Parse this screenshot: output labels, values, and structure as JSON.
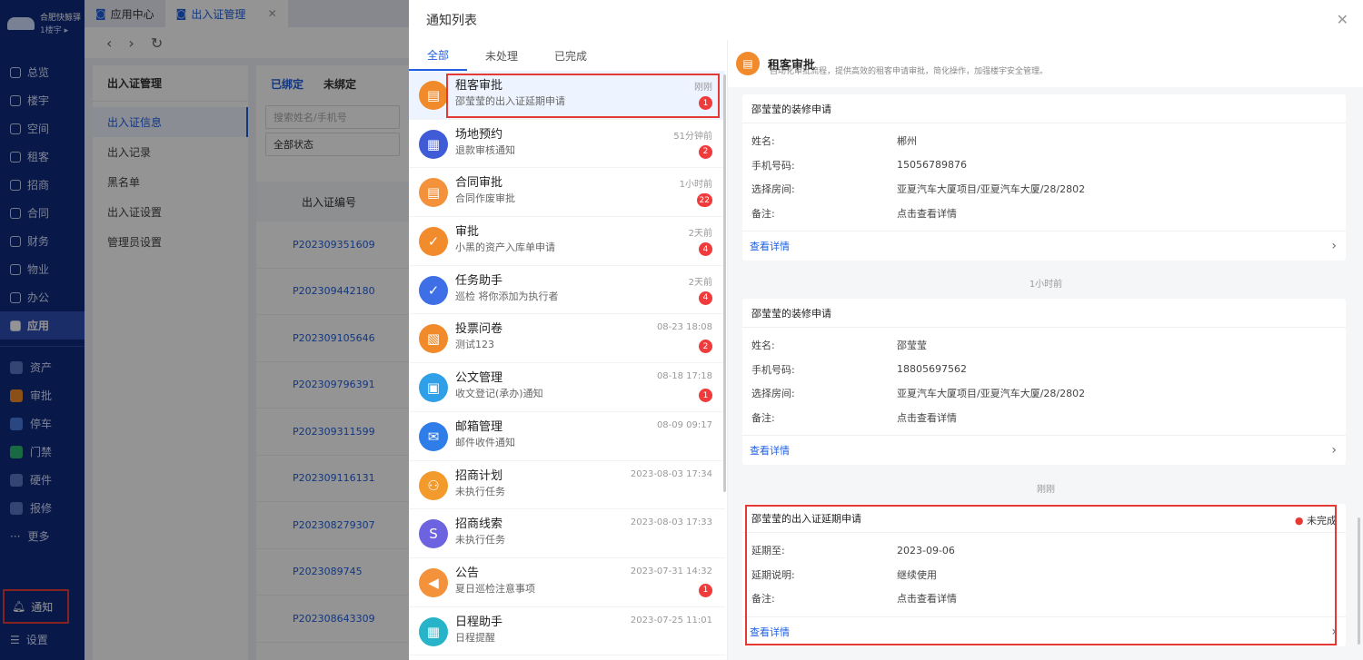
{
  "nav": {
    "brand": "合肥快鲸驿",
    "building": "1楼宇",
    "items": [
      "总览",
      "楼宇",
      "空间",
      "租客",
      "招商",
      "合同",
      "财务",
      "物业",
      "办公",
      "应用"
    ],
    "apps": [
      {
        "label": "资产",
        "color": "#5b78c9"
      },
      {
        "label": "审批",
        "color": "#f08a2a"
      },
      {
        "label": "停车",
        "color": "#4a7be0"
      },
      {
        "label": "门禁",
        "color": "#2bb673"
      },
      {
        "label": "硬件",
        "color": "#5b78c9"
      },
      {
        "label": "报修",
        "color": "#5b78c9"
      }
    ],
    "more": "更多",
    "notify": "通知",
    "settings": "设置"
  },
  "bg": {
    "tabs": [
      "应用中心",
      "出入证管理"
    ],
    "side_title": "出入证管理",
    "side_items": [
      "出入证信息",
      "出入记录",
      "黑名单",
      "出入证设置",
      "管理员设置"
    ],
    "main_tabs": [
      "已绑定",
      "未绑定"
    ],
    "search_placeholder": "搜索姓名/手机号",
    "status_select": "全部状态",
    "col_header": "出入证编号",
    "rows": [
      "P202309351609",
      "P202309442180",
      "P202309105646",
      "P202309796391",
      "P202309311599",
      "P202309116131",
      "P202308279307",
      "P2023089745",
      "P202308643309"
    ]
  },
  "drawer": {
    "title": "通知列表",
    "tabs": [
      "全部",
      "未处理",
      "已完成"
    ],
    "list": [
      {
        "title": "租客审批",
        "sub": "邵莹莹的出入证延期申请",
        "time": "刚刚",
        "badge": "1",
        "color": "#f08a2a",
        "glyph": "▤"
      },
      {
        "title": "场地预约",
        "sub": "退款审核通知",
        "time": "51分钟前",
        "badge": "2",
        "color": "#3f5bd6",
        "glyph": "▦"
      },
      {
        "title": "合同审批",
        "sub": "合同作废审批",
        "time": "1小时前",
        "badge": "22",
        "color": "#f3923a",
        "glyph": "▤"
      },
      {
        "title": "审批",
        "sub": "小黑的资产入库单申请",
        "time": "2天前",
        "badge": "4",
        "color": "#f28b2c",
        "glyph": "✓"
      },
      {
        "title": "任务助手",
        "sub": "巡检 将你添加为执行者",
        "time": "2天前",
        "badge": "4",
        "color": "#3e6fe6",
        "glyph": "✓"
      },
      {
        "title": "投票问卷",
        "sub": "测试123",
        "time": "08-23 18:08",
        "badge": "2",
        "color": "#f08a2a",
        "glyph": "▧"
      },
      {
        "title": "公文管理",
        "sub": "收文登记(承办)通知",
        "time": "08-18 17:18",
        "badge": "1",
        "color": "#2fa0e8",
        "glyph": "▣"
      },
      {
        "title": "邮箱管理",
        "sub": "邮件收件通知",
        "time": "08-09 09:17",
        "badge": "",
        "color": "#2f7de8",
        "glyph": "✉"
      },
      {
        "title": "招商计划",
        "sub": "未执行任务",
        "time": "2023-08-03 17:34",
        "badge": "",
        "color": "#f39a2c",
        "glyph": "⚇"
      },
      {
        "title": "招商线索",
        "sub": "未执行任务",
        "time": "2023-08-03 17:33",
        "badge": "",
        "color": "#6d62e0",
        "glyph": "S"
      },
      {
        "title": "公告",
        "sub": "夏日巡检注意事项",
        "time": "2023-07-31 14:32",
        "badge": "1",
        "color": "#f3923a",
        "glyph": "◀"
      },
      {
        "title": "日程助手",
        "sub": "日程提醒",
        "time": "2023-07-25 11:01",
        "badge": "",
        "color": "#27b4c9",
        "glyph": "▦"
      }
    ],
    "detail": {
      "title": "租客审批",
      "subtitle": "自动化审批流程，提供高效的租客申请审批，简化操作，加强楼宇安全管理。",
      "cards": [
        {
          "header": "邵莹莹的装修申请",
          "fields": [
            [
              "姓名:",
              "郴州"
            ],
            [
              "手机号码:",
              "15056789876"
            ],
            [
              "选择房间:",
              "亚夏汽车大厦项目/亚夏汽车大厦/28/2802"
            ],
            [
              "备注:",
              "点击查看详情"
            ]
          ],
          "more": "查看详情"
        },
        {
          "header": "邵莹莹的装修申请",
          "fields": [
            [
              "姓名:",
              "邵莹莹"
            ],
            [
              "手机号码:",
              "18805697562"
            ],
            [
              "选择房间:",
              "亚夏汽车大厦项目/亚夏汽车大厦/28/2802"
            ],
            [
              "备注:",
              "点击查看详情"
            ]
          ],
          "more": "查看详情"
        },
        {
          "header": "邵莹莹的出入证延期申请",
          "status": "未完成",
          "fields": [
            [
              "延期至:",
              "2023-09-06"
            ],
            [
              "延期说明:",
              "继续使用"
            ],
            [
              "备注:",
              "点击查看详情"
            ]
          ],
          "more": "查看详情"
        }
      ],
      "stamps": [
        "1小时前",
        "刚刚"
      ]
    }
  }
}
